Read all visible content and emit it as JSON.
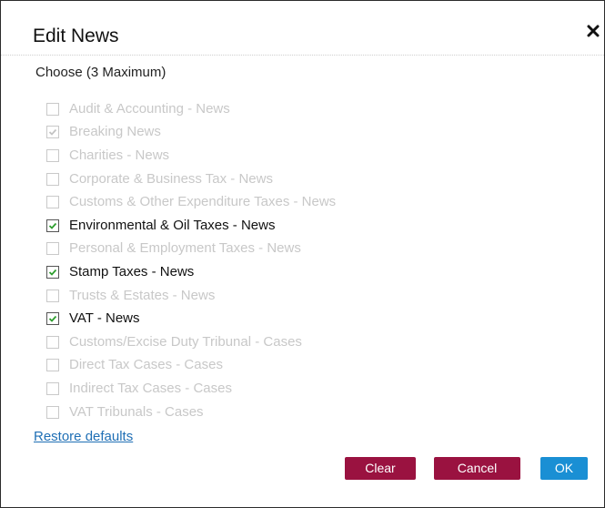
{
  "dialog": {
    "title": "Edit News",
    "close_icon": "close-icon",
    "subtitle": "Choose (3 Maximum)",
    "options": [
      {
        "label": "Audit & Accounting - News",
        "checked": false,
        "enabled": false
      },
      {
        "label": "Breaking News",
        "checked": true,
        "enabled": false
      },
      {
        "label": "Charities - News",
        "checked": false,
        "enabled": false
      },
      {
        "label": "Corporate & Business Tax - News",
        "checked": false,
        "enabled": false
      },
      {
        "label": "Customs & Other Expenditure Taxes - News",
        "checked": false,
        "enabled": false
      },
      {
        "label": "Environmental & Oil Taxes - News",
        "checked": true,
        "enabled": true
      },
      {
        "label": "Personal & Employment Taxes - News",
        "checked": false,
        "enabled": false
      },
      {
        "label": "Stamp Taxes - News",
        "checked": true,
        "enabled": true
      },
      {
        "label": "Trusts & Estates - News",
        "checked": false,
        "enabled": false
      },
      {
        "label": "VAT - News",
        "checked": true,
        "enabled": true
      },
      {
        "label": "Customs/Excise Duty Tribunal - Cases",
        "checked": false,
        "enabled": false
      },
      {
        "label": "Direct Tax Cases - Cases",
        "checked": false,
        "enabled": false
      },
      {
        "label": "Indirect Tax Cases - Cases",
        "checked": false,
        "enabled": false
      },
      {
        "label": "VAT Tribunals - Cases",
        "checked": false,
        "enabled": false
      }
    ],
    "restore_label": "Restore defaults",
    "buttons": {
      "clear_label": "Clear",
      "cancel_label": "Cancel",
      "ok_label": "OK"
    }
  },
  "colors": {
    "primary_button": "#9a1240",
    "ok_button": "#1a8fd4",
    "checkmark": "#2e9e2e",
    "link": "#1f6fb5",
    "disabled_text": "#c8c8c8"
  }
}
